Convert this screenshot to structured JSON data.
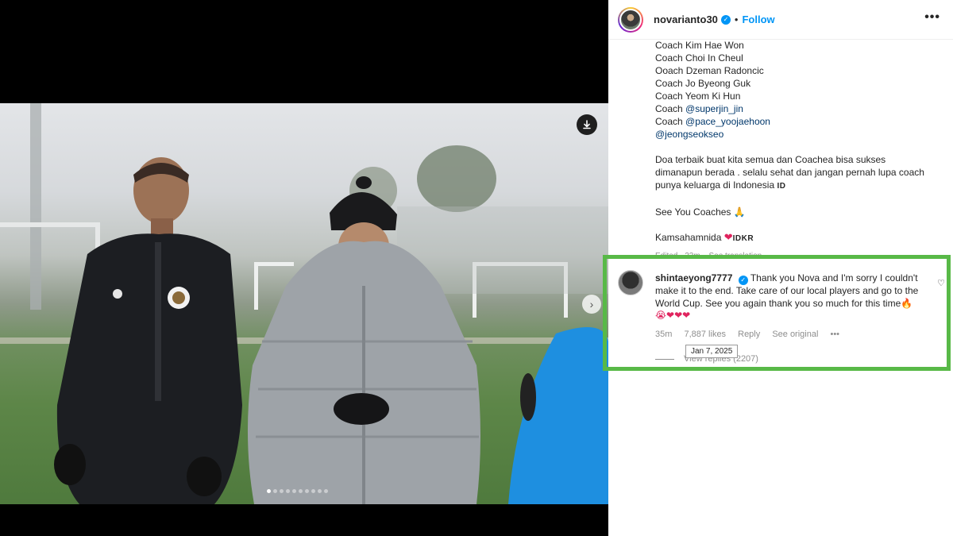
{
  "post": {
    "username": "novarianto30",
    "bullet": "•",
    "follow_label": "Follow",
    "more_label": "•••",
    "caption": {
      "coach_lines": [
        "Coach Kim Hae Won",
        "Coach Choi In Cheul",
        "Ooach Dzeman Radoncic",
        "Coach Jo Byeong Guk",
        "Coach Yeom Ki Hun"
      ],
      "coach_word": "Coach",
      "mentions": [
        "@superjin_jin",
        "@pace_yoojaehoon",
        "@jeongseokseo"
      ],
      "paragraph_lines": [
        "Doa terbaik buat kita semua dan Coachea bisa sukses",
        "dimanapun berada . selalu sehat dan jangan pernah lupa coach",
        "punya keluarga di Indonesia"
      ],
      "flag_id": "ID",
      "see_you": "See You Coaches",
      "pray_emoji": "🙏",
      "thanks": "Kamsahamnida",
      "flag_kr": "IDKR",
      "edited": "Edited · 23m",
      "see_translation": "See translation"
    }
  },
  "comment": {
    "username": "shintaeyong7777",
    "text": "Thank you Nova and I'm sorry I couldn't make it to the end. Take care of our local players and go to the World Cup. See you again thank you so much for this time",
    "fire": "🔥",
    "emojis": "😭❤❤❤",
    "time": "35m",
    "likes": "7,887 likes",
    "reply": "Reply",
    "see_original": "See original",
    "more": "•••",
    "tooltip": "Jan 7, 2025",
    "view_replies": "View replies (2207)",
    "like_icon": "♡"
  },
  "media": {
    "slide_count": 10,
    "active_slide": 1
  },
  "colors": {
    "highlight": "#58b947",
    "link": "#0095f6",
    "mention": "#00376b"
  }
}
